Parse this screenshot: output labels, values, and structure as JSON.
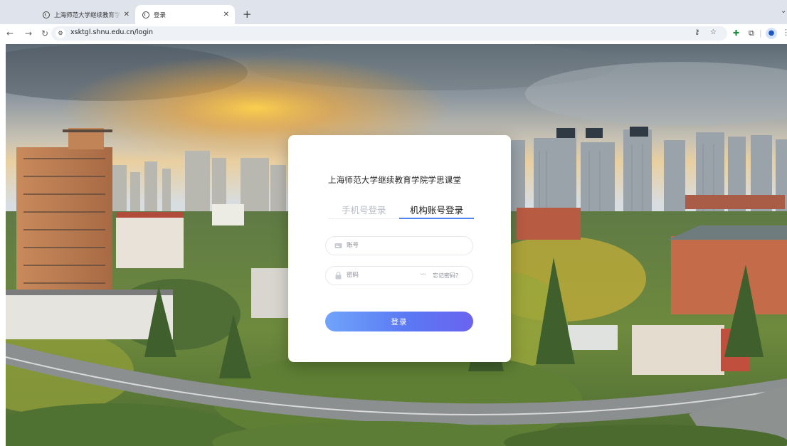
{
  "browser": {
    "tabs": [
      {
        "title": "上海师范大学继续教育学院学思课堂",
        "active": false
      },
      {
        "title": "登录",
        "active": true
      }
    ],
    "new_tab": "+",
    "url": "xsktgl.shnu.edu.cn/login"
  },
  "login": {
    "title": "上海师范大学继续教育学院学思课堂",
    "tab_phone": "手机号登录",
    "tab_org": "机构账号登录",
    "active_tab": "机构账号登录",
    "account_placeholder": "账号",
    "password_placeholder": "密码",
    "forgot_password": "忘记密码?",
    "submit": "登录"
  },
  "colors": {
    "accent": "#4f84f5",
    "button_gradient_start": "#70a4fb",
    "button_gradient_end": "#6a63f1"
  }
}
